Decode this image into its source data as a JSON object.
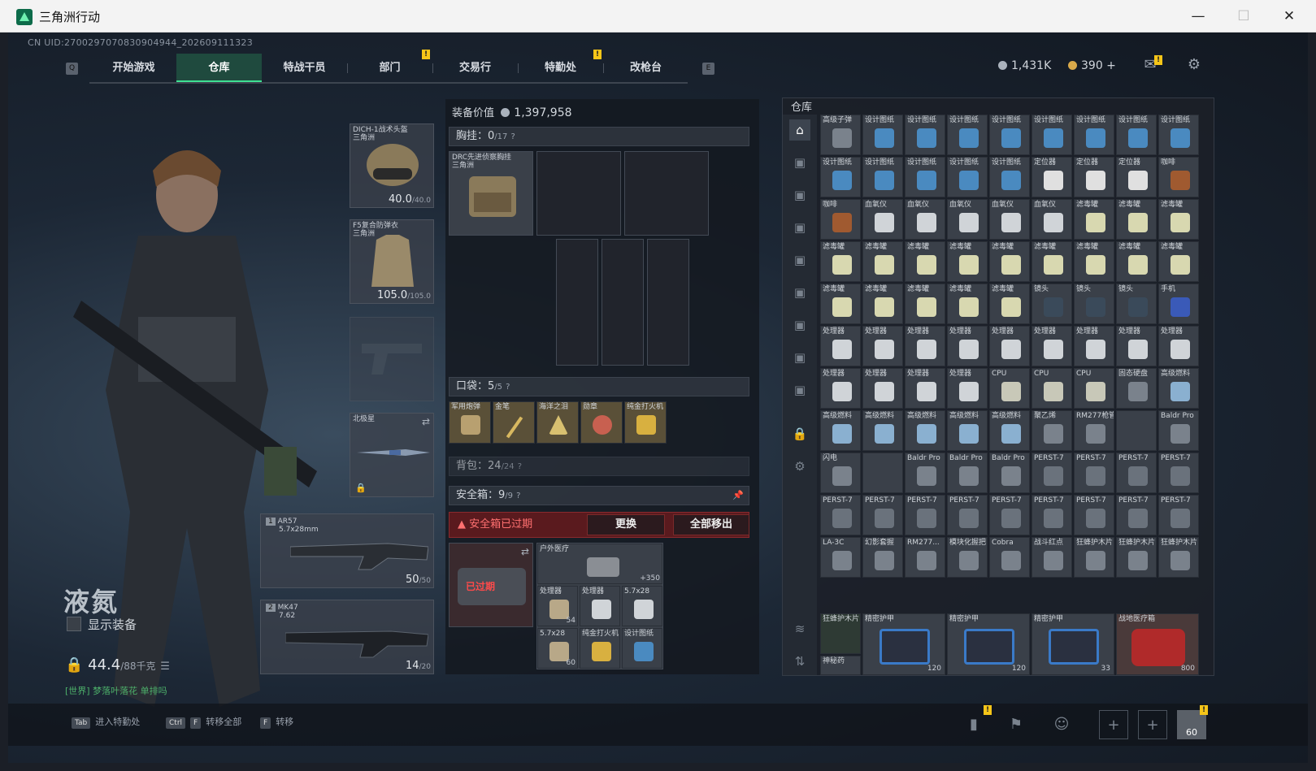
{
  "window": {
    "title": "三角洲行动",
    "minimize": "—",
    "maximize": "☐",
    "close": "✕"
  },
  "uid": "CN UID:2700297070830904944_202609111323",
  "nav": {
    "key_left": "Q",
    "key_right": "E",
    "tabs": [
      "开始游戏",
      "仓库",
      "特战干员",
      "部门",
      "交易行",
      "特勤处",
      "改枪台"
    ],
    "active_tab": "仓库",
    "badge": "!"
  },
  "currency": {
    "primary": "1,431K",
    "secondary": "390 +"
  },
  "character": {
    "name": "液氮",
    "show_equip": "显示装备",
    "weight": "44.4",
    "weight_max": "/88千克",
    "chat": "[世界] 梦落叶落花 单排吗"
  },
  "equip": {
    "helmet": {
      "label": "DICH-1战术头盔",
      "sub": "三角洲",
      "value": "40.0",
      "max": "/40.0"
    },
    "armor": {
      "label": "F5复合防弹衣",
      "sub": "三角洲",
      "value": "105.0",
      "max": "/105.0"
    },
    "melee": {
      "label": "北极星"
    },
    "weapon1": {
      "num": "1",
      "label": "AR57",
      "sub": "5.7x28mm",
      "value": "50",
      "max": "/50"
    },
    "weapon2": {
      "num": "2",
      "label": "MK47",
      "sub": "7.62",
      "value": "14",
      "max": "/20"
    }
  },
  "center": {
    "equip_value_label": "装备价值",
    "equip_value": "1,397,958",
    "chest_label": "胸挂：",
    "chest_count": "0",
    "chest_max": "/17",
    "chest_item": "DRC先进侦察胸挂",
    "chest_item_sub": "三角洲",
    "pocket_label": "口袋：",
    "pocket_count": "5",
    "pocket_max": "/5",
    "pocket_items": [
      "军用炮弹",
      "金笔",
      "海洋之泪",
      "勋章",
      "纯金打火机"
    ],
    "backpack_label": "背包：",
    "backpack_count": "24",
    "backpack_max": "/24",
    "safe_label": "安全箱：",
    "safe_count": "9",
    "safe_max": "/9",
    "expired": "安全箱已过期",
    "replace": "更换",
    "move_all": "全部移出",
    "expired_stamp": "已过期",
    "safe_items": [
      "户外医疗",
      "处理器",
      "处理器",
      "5.7x28",
      "处理器",
      "处理器",
      "5.7x28",
      "纯金打火机",
      "设计图纸"
    ],
    "safe_count_a": "+350",
    "safe_count_b": "54",
    "safe_count_c": "60"
  },
  "storage": {
    "title": "仓库",
    "rows": [
      [
        "高级子弹",
        "设计图纸",
        "设计图纸",
        "设计图纸",
        "设计图纸",
        "设计图纸",
        "设计图纸",
        "设计图纸",
        "设计图纸"
      ],
      [
        "设计图纸",
        "设计图纸",
        "设计图纸",
        "设计图纸",
        "设计图纸",
        "定位器",
        "定位器",
        "定位器",
        "咖啡"
      ],
      [
        "咖啡",
        "血氧仪",
        "血氧仪",
        "血氧仪",
        "血氧仪",
        "血氧仪",
        "滤毒罐",
        "滤毒罐",
        "滤毒罐"
      ],
      [
        "滤毒罐",
        "滤毒罐",
        "滤毒罐",
        "滤毒罐",
        "滤毒罐",
        "滤毒罐",
        "滤毒罐",
        "滤毒罐",
        "滤毒罐"
      ],
      [
        "滤毒罐",
        "滤毒罐",
        "滤毒罐",
        "滤毒罐",
        "滤毒罐",
        "镜头",
        "镜头",
        "镜头",
        "手机"
      ],
      [
        "处理器",
        "处理器",
        "处理器",
        "处理器",
        "处理器",
        "处理器",
        "处理器",
        "处理器",
        "处理器"
      ],
      [
        "处理器",
        "处理器",
        "处理器",
        "处理器",
        "CPU",
        "CPU",
        "CPU",
        "固态硬盘",
        "高级燃料"
      ],
      [
        "高级燃料",
        "高级燃料",
        "高级燃料",
        "高级燃料",
        "高级燃料",
        "聚乙烯",
        "RM277枪管组合",
        "",
        "Baldr Pro"
      ],
      [
        "闪电",
        "",
        "Baldr Pro",
        "Baldr Pro",
        "Baldr Pro",
        "PERST-7",
        "PERST-7",
        "PERST-7",
        "PERST-7"
      ],
      [
        "PERST-7",
        "PERST-7",
        "PERST-7",
        "PERST-7",
        "PERST-7",
        "PERST-7",
        "PERST-7",
        "PERST-7",
        "PERST-7"
      ],
      [
        "LA-3C",
        "幻影套握",
        "RM277...",
        "模块化握把",
        "Cobra",
        "战斗红点",
        "狂蜂护木片",
        "狂蜂护木片",
        "狂蜂护木片"
      ]
    ],
    "row12_first": "狂蜂护木片",
    "row13_first": "神秘药",
    "bags": [
      "精密护甲",
      "精密护甲",
      "精密护甲",
      "战地医疗箱"
    ],
    "bag_counts": [
      "120",
      "120",
      "33",
      "800"
    ]
  },
  "bottom": {
    "tab_hint": "进入特勤处",
    "ctrlf_hint": "转移全部",
    "f_hint": "转移",
    "tab": "Tab",
    "ctrl": "Ctrl",
    "f": "F",
    "level": "60"
  }
}
